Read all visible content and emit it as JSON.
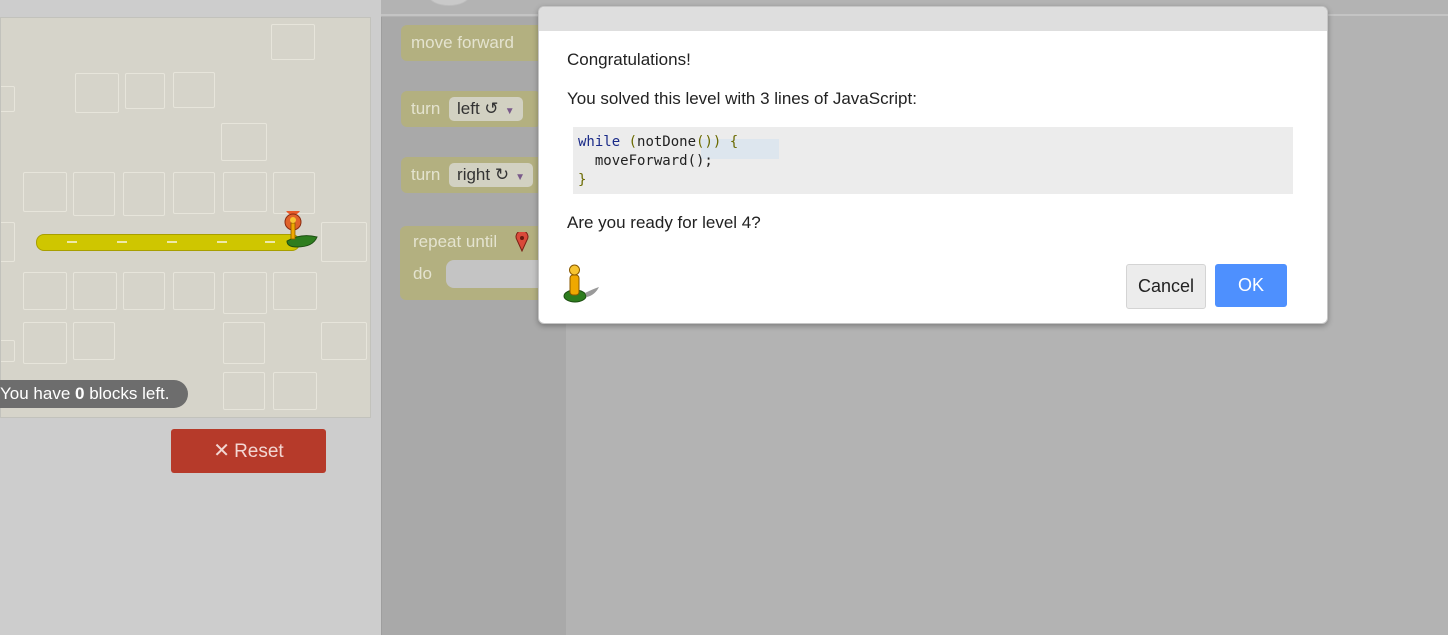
{
  "game": {
    "blocks_left_prefix": "You have ",
    "blocks_left_count": "0",
    "blocks_left_suffix": " blocks left.",
    "reset_label": "Reset"
  },
  "toolbox": {
    "move_forward": "move forward",
    "turn_left_label": "turn",
    "turn_left_value": "left ↺",
    "turn_right_label": "turn",
    "turn_right_value": "right ↻",
    "repeat_until": "repeat until",
    "do_label": "do"
  },
  "dialog": {
    "title": "Congratulations!",
    "message": "You solved this level with 3 lines of JavaScript:",
    "code": {
      "line1_kw": "while",
      "line1_open": " (",
      "line1_call": "notDone",
      "line1_close": "()) {",
      "line2": "  moveForward();",
      "line3": "}"
    },
    "question": "Are you ready for level 4?",
    "cancel_label": "Cancel",
    "ok_label": "OK"
  },
  "colors": {
    "ok_button": "#4e90fe",
    "reset_button": "#b63a2a",
    "path": "#cfc600",
    "block": "#b3b080"
  }
}
